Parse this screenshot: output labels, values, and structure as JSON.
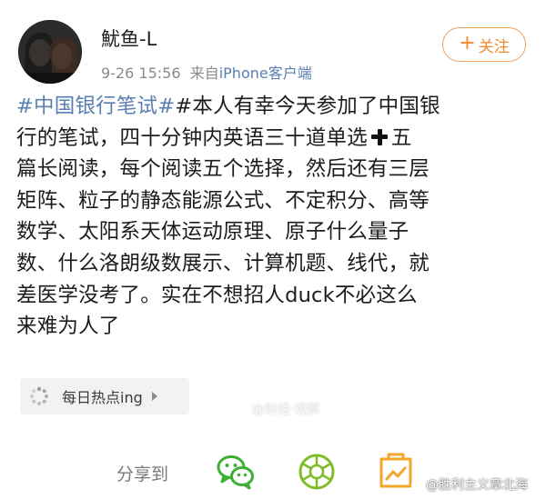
{
  "user": {
    "name": "魷鱼-L",
    "time": "9-26 15:56",
    "source_prefix": "来自",
    "source": "iPhone客户端"
  },
  "follow_button": {
    "plus": "+",
    "label": "关注"
  },
  "post": {
    "topic": "#中国银行笔试#",
    "line1": "#本人有幸今天参加了中国银",
    "line2a": "行的笔试，四十分钟内英语三十道单选",
    "line2b": "五",
    "line3": "篇长阅读，每个阅读五个选择，然后还有三层",
    "line4": "矩阵、粒子的静态能源公式、不定积分、高等",
    "line5": "数学、太阳系天体运动原理、原子什么量子",
    "line6": "数、什么洛朗级数展示、计算机题、线代，就",
    "line7": "差医学没考了。实在不想招人duck不必这么",
    "line8": "来难为人了"
  },
  "chip": {
    "label": "每日热点ing",
    "icon": "loading-dots-icon"
  },
  "watermark_mid": "@财经·观察",
  "share": {
    "label": "分享到",
    "targets": [
      {
        "name": "wechat",
        "icon": "wechat-icon",
        "color": "#3cb034"
      },
      {
        "name": "moments",
        "icon": "moments-icon",
        "color": "#7fbd27"
      },
      {
        "name": "favorite",
        "icon": "favorite-icon",
        "color": "#f3a62b"
      }
    ]
  },
  "watermark": "@胜利主义章北海"
}
